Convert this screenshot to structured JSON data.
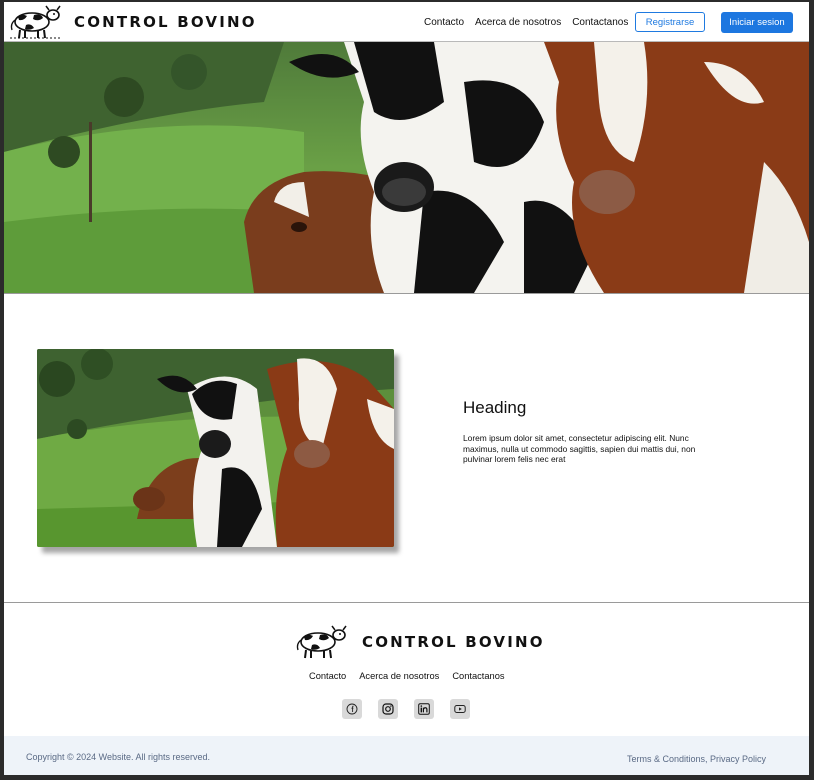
{
  "brand": {
    "name": "CONTROL BOVINO",
    "logo_icon": "cow-icon"
  },
  "header": {
    "nav": [
      "Contacto",
      "Acerca de nosotros",
      "Contactanos"
    ],
    "register_label": "Registrarse",
    "login_label": "Iniciar sesion"
  },
  "feature": {
    "heading": "Heading",
    "body": "Lorem ipsum dolor sit amet, consectetur adipiscing elit. Nunc maximus, nulla ut commodo sagittis, sapien dui mattis dui, non pulvinar lorem felis nec erat"
  },
  "footer": {
    "nav": [
      "Contacto",
      "Acerca de nosotros",
      "Contactanos"
    ],
    "socials": [
      "facebook-icon",
      "instagram-icon",
      "linkedin-icon",
      "youtube-icon"
    ],
    "copyright": "Copyright © 2024 Website. All rights reserved.",
    "terms": "Terms & Conditions",
    "separator": ", ",
    "privacy": "Privacy Policy"
  },
  "colors": {
    "primary": "#1d77e0",
    "footer_bg": "#eef3f9",
    "footer_text": "#5a6a85"
  }
}
